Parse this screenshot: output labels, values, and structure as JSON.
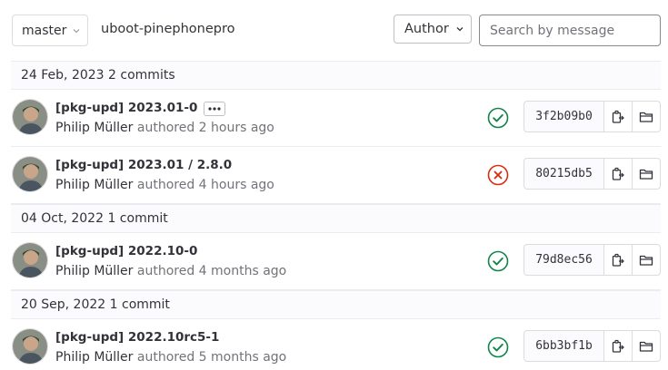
{
  "toolbar": {
    "branch": "master",
    "path": "uboot-pinephonepro",
    "author_label": "Author",
    "search_placeholder": "Search by message"
  },
  "groups": [
    {
      "date": "24 Feb, 2023",
      "count": "2 commits",
      "commits": [
        {
          "title": "[pkg-upd] 2023.01-0",
          "author": "Philip Müller",
          "verb": "authored",
          "time": "2 hours ago",
          "status": "success",
          "sha": "3f2b09b0",
          "has_ellipsis": true
        },
        {
          "title": "[pkg-upd] 2023.01 / 2.8.0",
          "author": "Philip Müller",
          "verb": "authored",
          "time": "4 hours ago",
          "status": "failed",
          "sha": "80215db5",
          "has_ellipsis": false
        }
      ]
    },
    {
      "date": "04 Oct, 2022",
      "count": "1 commit",
      "commits": [
        {
          "title": "[pkg-upd] 2022.10-0",
          "author": "Philip Müller",
          "verb": "authored",
          "time": "4 months ago",
          "status": "success",
          "sha": "79d8ec56",
          "has_ellipsis": false
        }
      ]
    },
    {
      "date": "20 Sep, 2022",
      "count": "1 commit",
      "commits": [
        {
          "title": "[pkg-upd] 2022.10rc5-1",
          "author": "Philip Müller",
          "verb": "authored",
          "time": "5 months ago",
          "status": "success",
          "sha": "6bb3bf1b",
          "has_ellipsis": false
        }
      ]
    }
  ],
  "colors": {
    "success": "#108548",
    "failed": "#dd2b0e"
  },
  "icons": {
    "copy": "copy-icon",
    "browse": "folder-open-icon",
    "ellipsis": "ellipsis-icon",
    "chevron": "chevron-down-icon"
  }
}
